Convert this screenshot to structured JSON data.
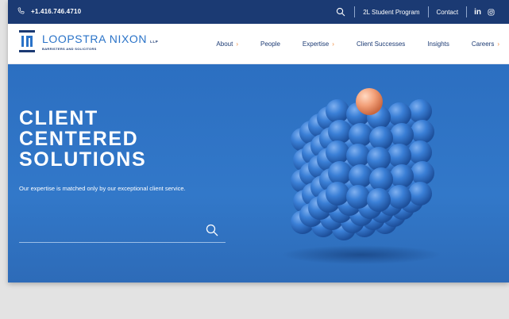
{
  "topbar": {
    "phone": "+1.416.746.4710",
    "links": [
      "2L Student Program",
      "Contact"
    ],
    "social": [
      "in",
      "ig"
    ]
  },
  "brand": {
    "name": "LOOPSTRA NIXON",
    "suffix": "LLP",
    "tagline": "BARRISTERS AND SOLICITORS"
  },
  "nav": {
    "items": [
      {
        "label": "About",
        "chevron": true
      },
      {
        "label": "People",
        "chevron": false
      },
      {
        "label": "Expertise",
        "chevron": true
      },
      {
        "label": "Client Successes",
        "chevron": false
      },
      {
        "label": "Insights",
        "chevron": false
      },
      {
        "label": "Careers",
        "chevron": true
      }
    ]
  },
  "hero": {
    "title_lines": [
      "CLIENT",
      "CENTERED",
      "SOLUTIONS"
    ],
    "subtitle": "Our expertise is matched only by our exceptional client service.",
    "search_placeholder": ""
  },
  "colors": {
    "topbar_bg": "#1b3a73",
    "hero_bg": "#2f72c4",
    "accent": "#f08a3b",
    "brand_blue": "#2a73c8"
  }
}
